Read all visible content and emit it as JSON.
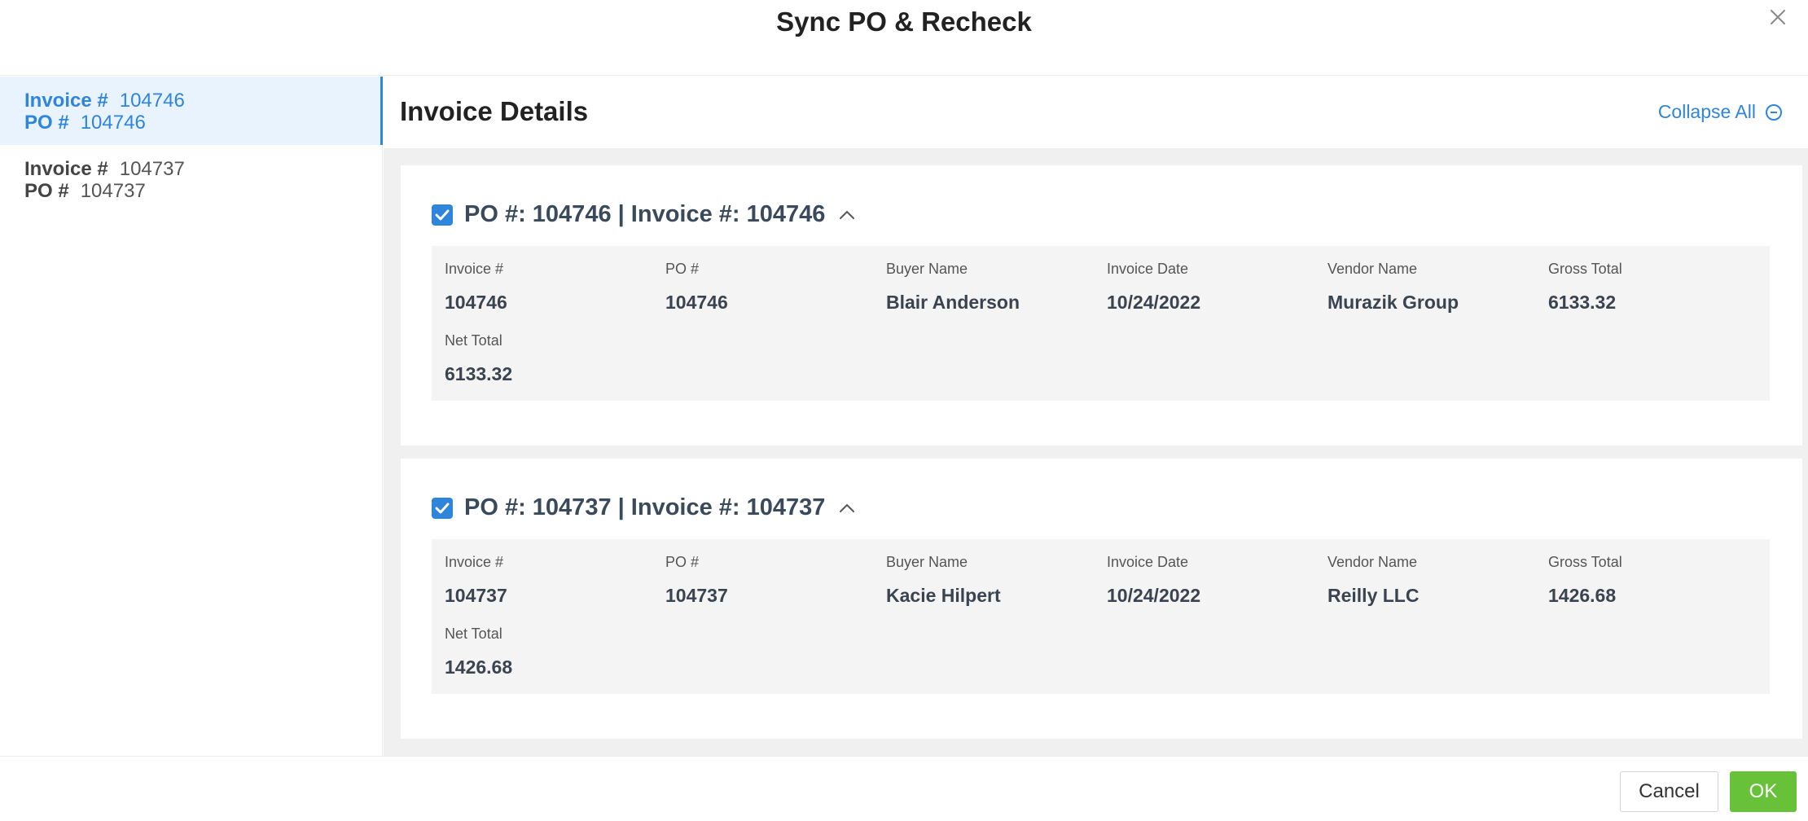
{
  "dialog": {
    "title": "Sync PO & Recheck"
  },
  "sidebar": {
    "items": [
      {
        "invoice_label": "Invoice #",
        "invoice_value": "104746",
        "po_label": "PO #",
        "po_value": "104746",
        "active": true
      },
      {
        "invoice_label": "Invoice #",
        "invoice_value": "104737",
        "po_label": "PO #",
        "po_value": "104737",
        "active": false
      }
    ]
  },
  "main": {
    "title": "Invoice Details",
    "collapse_all_label": "Collapse All",
    "cards": [
      {
        "checked": true,
        "title": "PO #: 104746 | Invoice #: 104746",
        "fields": [
          {
            "label": "Invoice #",
            "value": "104746"
          },
          {
            "label": "PO #",
            "value": "104746"
          },
          {
            "label": "Buyer Name",
            "value": "Blair Anderson"
          },
          {
            "label": "Invoice Date",
            "value": "10/24/2022"
          },
          {
            "label": "Vendor Name",
            "value": "Murazik Group"
          },
          {
            "label": "Gross Total",
            "value": "6133.32"
          },
          {
            "label": "Net Total",
            "value": "6133.32"
          }
        ]
      },
      {
        "checked": true,
        "title": "PO #: 104737 | Invoice #: 104737",
        "fields": [
          {
            "label": "Invoice #",
            "value": "104737"
          },
          {
            "label": "PO #",
            "value": "104737"
          },
          {
            "label": "Buyer Name",
            "value": "Kacie Hilpert"
          },
          {
            "label": "Invoice Date",
            "value": "10/24/2022"
          },
          {
            "label": "Vendor Name",
            "value": "Reilly LLC"
          },
          {
            "label": "Gross Total",
            "value": "1426.68"
          },
          {
            "label": "Net Total",
            "value": "1426.68"
          }
        ]
      }
    ]
  },
  "footer": {
    "cancel_label": "Cancel",
    "ok_label": "OK"
  },
  "colors": {
    "accent": "#2f84dc",
    "ok": "#67c23a",
    "active_bg": "#e8f3fd"
  }
}
